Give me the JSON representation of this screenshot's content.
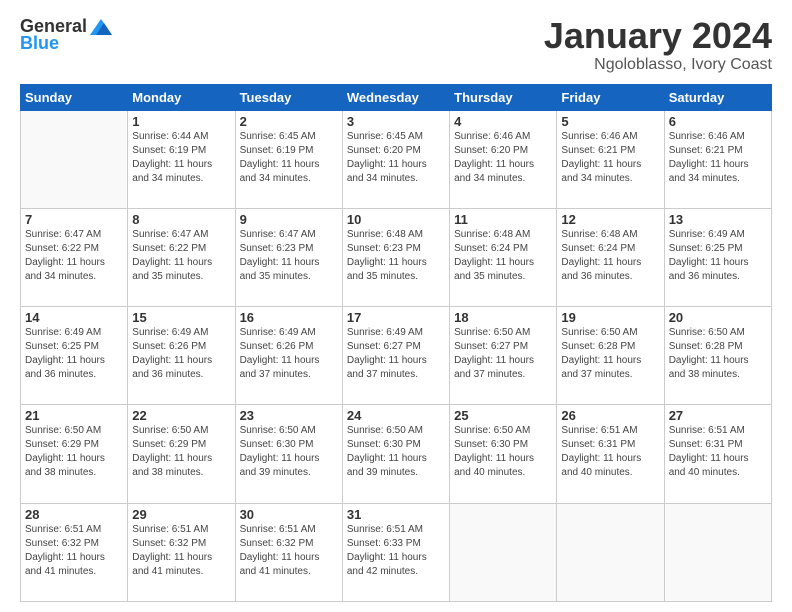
{
  "header": {
    "logo": {
      "general": "General",
      "blue": "Blue"
    },
    "title": "January 2024",
    "subtitle": "Ngoloblasso, Ivory Coast"
  },
  "days_of_week": [
    "Sunday",
    "Monday",
    "Tuesday",
    "Wednesday",
    "Thursday",
    "Friday",
    "Saturday"
  ],
  "weeks": [
    [
      {
        "day": "",
        "info": ""
      },
      {
        "day": "1",
        "info": "Sunrise: 6:44 AM\nSunset: 6:19 PM\nDaylight: 11 hours\nand 34 minutes."
      },
      {
        "day": "2",
        "info": "Sunrise: 6:45 AM\nSunset: 6:19 PM\nDaylight: 11 hours\nand 34 minutes."
      },
      {
        "day": "3",
        "info": "Sunrise: 6:45 AM\nSunset: 6:20 PM\nDaylight: 11 hours\nand 34 minutes."
      },
      {
        "day": "4",
        "info": "Sunrise: 6:46 AM\nSunset: 6:20 PM\nDaylight: 11 hours\nand 34 minutes."
      },
      {
        "day": "5",
        "info": "Sunrise: 6:46 AM\nSunset: 6:21 PM\nDaylight: 11 hours\nand 34 minutes."
      },
      {
        "day": "6",
        "info": "Sunrise: 6:46 AM\nSunset: 6:21 PM\nDaylight: 11 hours\nand 34 minutes."
      }
    ],
    [
      {
        "day": "7",
        "info": "Sunrise: 6:47 AM\nSunset: 6:22 PM\nDaylight: 11 hours\nand 34 minutes."
      },
      {
        "day": "8",
        "info": "Sunrise: 6:47 AM\nSunset: 6:22 PM\nDaylight: 11 hours\nand 35 minutes."
      },
      {
        "day": "9",
        "info": "Sunrise: 6:47 AM\nSunset: 6:23 PM\nDaylight: 11 hours\nand 35 minutes."
      },
      {
        "day": "10",
        "info": "Sunrise: 6:48 AM\nSunset: 6:23 PM\nDaylight: 11 hours\nand 35 minutes."
      },
      {
        "day": "11",
        "info": "Sunrise: 6:48 AM\nSunset: 6:24 PM\nDaylight: 11 hours\nand 35 minutes."
      },
      {
        "day": "12",
        "info": "Sunrise: 6:48 AM\nSunset: 6:24 PM\nDaylight: 11 hours\nand 36 minutes."
      },
      {
        "day": "13",
        "info": "Sunrise: 6:49 AM\nSunset: 6:25 PM\nDaylight: 11 hours\nand 36 minutes."
      }
    ],
    [
      {
        "day": "14",
        "info": "Sunrise: 6:49 AM\nSunset: 6:25 PM\nDaylight: 11 hours\nand 36 minutes."
      },
      {
        "day": "15",
        "info": "Sunrise: 6:49 AM\nSunset: 6:26 PM\nDaylight: 11 hours\nand 36 minutes."
      },
      {
        "day": "16",
        "info": "Sunrise: 6:49 AM\nSunset: 6:26 PM\nDaylight: 11 hours\nand 37 minutes."
      },
      {
        "day": "17",
        "info": "Sunrise: 6:49 AM\nSunset: 6:27 PM\nDaylight: 11 hours\nand 37 minutes."
      },
      {
        "day": "18",
        "info": "Sunrise: 6:50 AM\nSunset: 6:27 PM\nDaylight: 11 hours\nand 37 minutes."
      },
      {
        "day": "19",
        "info": "Sunrise: 6:50 AM\nSunset: 6:28 PM\nDaylight: 11 hours\nand 37 minutes."
      },
      {
        "day": "20",
        "info": "Sunrise: 6:50 AM\nSunset: 6:28 PM\nDaylight: 11 hours\nand 38 minutes."
      }
    ],
    [
      {
        "day": "21",
        "info": "Sunrise: 6:50 AM\nSunset: 6:29 PM\nDaylight: 11 hours\nand 38 minutes."
      },
      {
        "day": "22",
        "info": "Sunrise: 6:50 AM\nSunset: 6:29 PM\nDaylight: 11 hours\nand 38 minutes."
      },
      {
        "day": "23",
        "info": "Sunrise: 6:50 AM\nSunset: 6:30 PM\nDaylight: 11 hours\nand 39 minutes."
      },
      {
        "day": "24",
        "info": "Sunrise: 6:50 AM\nSunset: 6:30 PM\nDaylight: 11 hours\nand 39 minutes."
      },
      {
        "day": "25",
        "info": "Sunrise: 6:50 AM\nSunset: 6:30 PM\nDaylight: 11 hours\nand 40 minutes."
      },
      {
        "day": "26",
        "info": "Sunrise: 6:51 AM\nSunset: 6:31 PM\nDaylight: 11 hours\nand 40 minutes."
      },
      {
        "day": "27",
        "info": "Sunrise: 6:51 AM\nSunset: 6:31 PM\nDaylight: 11 hours\nand 40 minutes."
      }
    ],
    [
      {
        "day": "28",
        "info": "Sunrise: 6:51 AM\nSunset: 6:32 PM\nDaylight: 11 hours\nand 41 minutes."
      },
      {
        "day": "29",
        "info": "Sunrise: 6:51 AM\nSunset: 6:32 PM\nDaylight: 11 hours\nand 41 minutes."
      },
      {
        "day": "30",
        "info": "Sunrise: 6:51 AM\nSunset: 6:32 PM\nDaylight: 11 hours\nand 41 minutes."
      },
      {
        "day": "31",
        "info": "Sunrise: 6:51 AM\nSunset: 6:33 PM\nDaylight: 11 hours\nand 42 minutes."
      },
      {
        "day": "",
        "info": ""
      },
      {
        "day": "",
        "info": ""
      },
      {
        "day": "",
        "info": ""
      }
    ]
  ]
}
